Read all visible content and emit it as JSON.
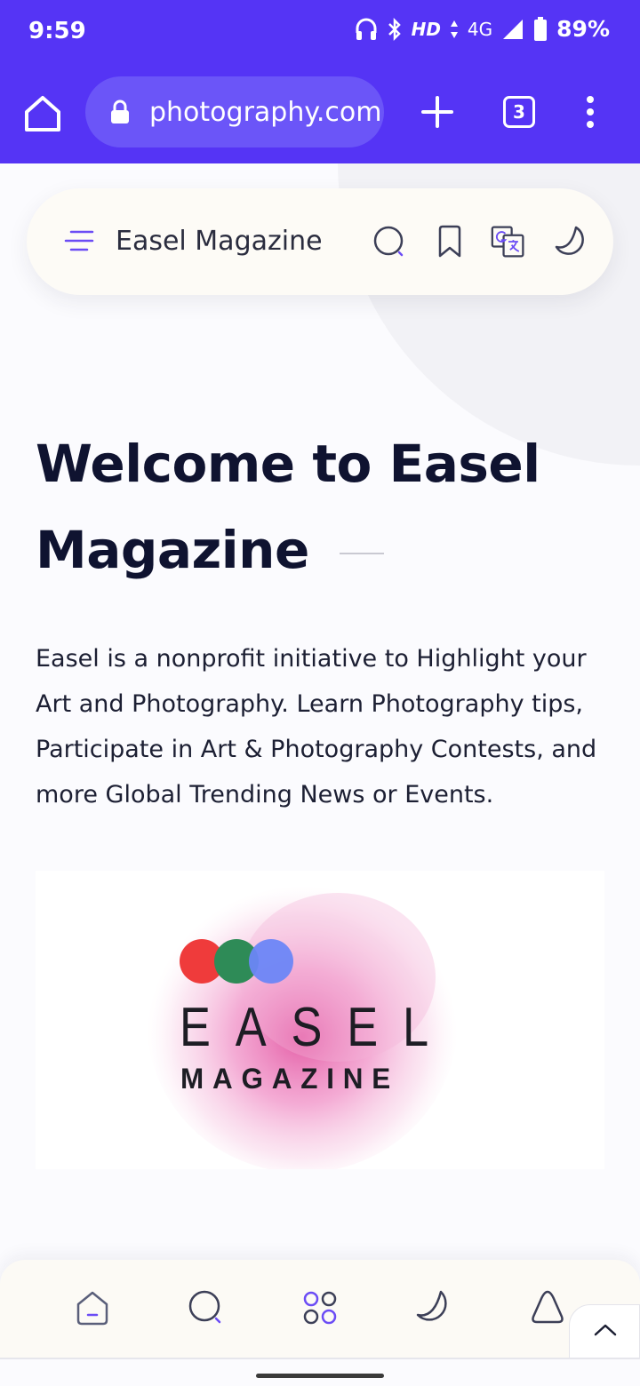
{
  "status_bar": {
    "time": "9:59",
    "hd": "HD",
    "network": "4G",
    "battery": "89%"
  },
  "browser": {
    "url": "photography.com",
    "tab_count": "3"
  },
  "header": {
    "site_name": "Easel Magazine",
    "icons": [
      "menu-icon",
      "search-icon",
      "bookmark-icon",
      "translate-icon",
      "moon-icon"
    ]
  },
  "hero": {
    "title": "Welcome to Easel Magazine",
    "intro": "Easel is a nonprofit initiative to Highlight your Art and Photography. Learn Photography tips, Participate in Art & Photography Contests, and more Global Trending News or Events."
  },
  "logo": {
    "word": "EASEL",
    "sub": "MAGAZINE",
    "dot_colors": [
      "#ef3b3b",
      "#2e8b57",
      "#6b86f7"
    ]
  },
  "bottom_nav": {
    "items": [
      "home-icon",
      "search-icon",
      "apps-icon",
      "moon-icon",
      "bell-icon"
    ]
  },
  "colors": {
    "accent": "#5534f5",
    "nav_icon": "#5a5f7a",
    "nav_accent": "#6b4cf5"
  }
}
